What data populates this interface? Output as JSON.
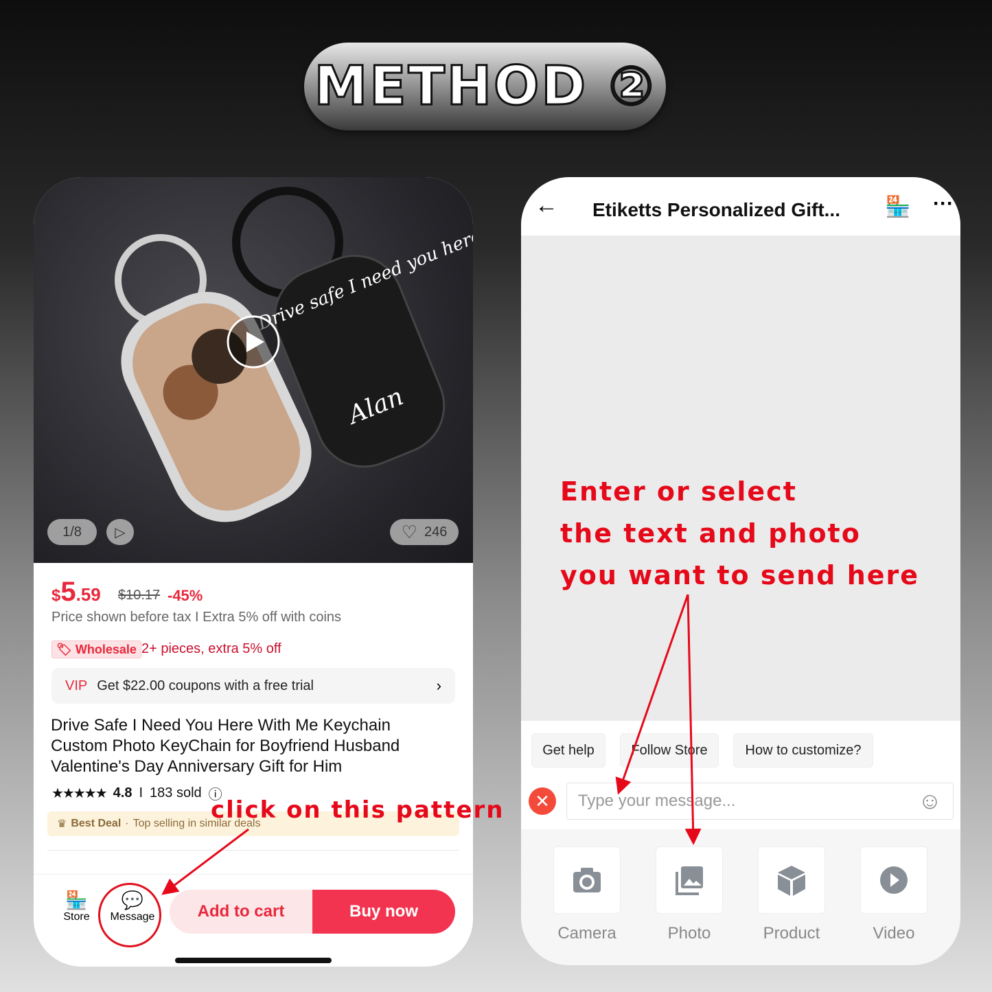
{
  "banner": {
    "title": "METHOD ②"
  },
  "product_page": {
    "image": {
      "counter": "1/8",
      "likes": "246",
      "keychain_text": "Drive safe I need you here with me",
      "keychain_name": "Alan"
    },
    "price": {
      "currency": "$",
      "integer": "5",
      "decimal": ".59",
      "original": "$10.17",
      "discount": "-45%",
      "note": "Price shown before tax I Extra 5% off with coins"
    },
    "wholesale": {
      "badge": "Wholesale",
      "text": "2+ pieces, extra 5% off"
    },
    "vip": {
      "label": "VIP",
      "text": "Get $22.00 coupons with a free trial"
    },
    "title": "Drive Safe I Need You Here With Me Keychain Custom Photo KeyChain for Boyfriend Husband Valentine's Day Anniversary Gift for Him",
    "rating": "4.8",
    "sold": "183 sold",
    "best_deal": {
      "label": "Best Deal",
      "text": "Top selling in similar deals"
    },
    "bottom_bar": {
      "store": "Store",
      "message": "Message",
      "add_to_cart": "Add to cart",
      "buy_now": "Buy now"
    },
    "annotation": "click on this pattern"
  },
  "chat_page": {
    "title": "Etiketts Personalized Gift...",
    "annotation": [
      "Enter or select",
      "the text and photo",
      "you want to send here"
    ],
    "quick_replies": [
      "Get help",
      "Follow Store",
      "How to customize?"
    ],
    "input_placeholder": "Type your message...",
    "attachments": [
      {
        "label": "Camera",
        "icon": "camera-icon"
      },
      {
        "label": "Photo",
        "icon": "photo-icon"
      },
      {
        "label": "Product",
        "icon": "box-icon"
      },
      {
        "label": "Video",
        "icon": "play-icon"
      }
    ]
  },
  "colors": {
    "accent": "#e8283c",
    "annotation": "#e5091a"
  }
}
